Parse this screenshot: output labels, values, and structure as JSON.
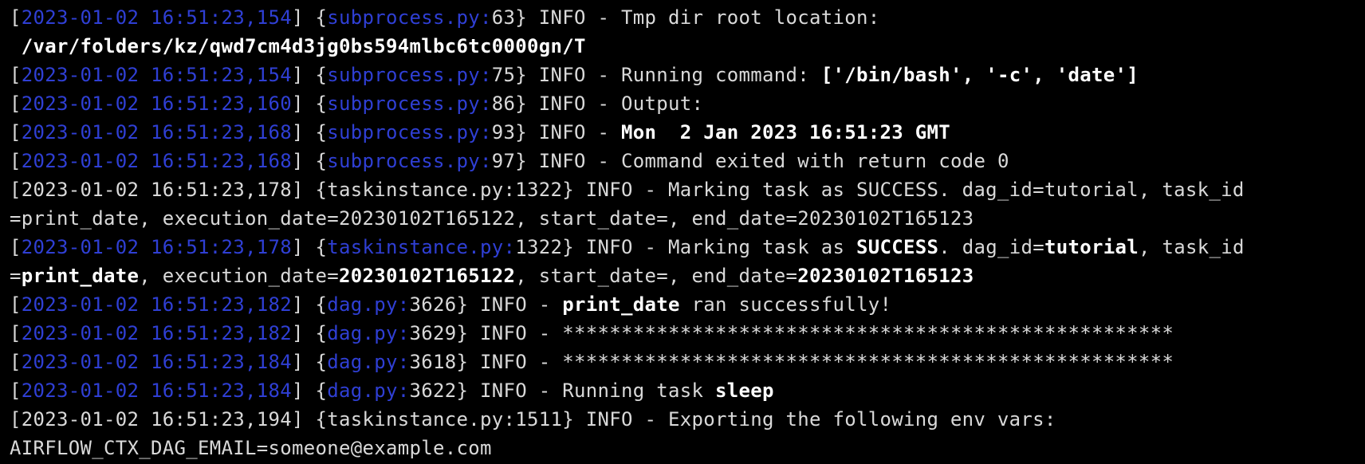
{
  "terminal": {
    "lines": [
      {
        "segments": [
          {
            "text": "[",
            "style": "plain"
          },
          {
            "text": "2023-01-02 16:51:23,154",
            "style": "ts"
          },
          {
            "text": "] {",
            "style": "plain"
          },
          {
            "text": "subprocess.py:",
            "style": "src"
          },
          {
            "text": "63} INFO - Tmp dir root location:",
            "style": "plain"
          }
        ]
      },
      {
        "segments": [
          {
            "text": " /var/folders/kz/qwd7cm4d3jg0bs594mlbc6tc0000gn/T",
            "style": "b"
          }
        ]
      },
      {
        "segments": [
          {
            "text": "[",
            "style": "plain"
          },
          {
            "text": "2023-01-02 16:51:23,154",
            "style": "ts"
          },
          {
            "text": "] {",
            "style": "plain"
          },
          {
            "text": "subprocess.py:",
            "style": "src"
          },
          {
            "text": "75} INFO - Running command: ",
            "style": "plain"
          },
          {
            "text": "['/bin/bash', '-c', 'date']",
            "style": "b"
          }
        ]
      },
      {
        "segments": [
          {
            "text": "[",
            "style": "plain"
          },
          {
            "text": "2023-01-02 16:51:23,160",
            "style": "ts"
          },
          {
            "text": "] {",
            "style": "plain"
          },
          {
            "text": "subprocess.py:",
            "style": "src"
          },
          {
            "text": "86} INFO - Output:",
            "style": "plain"
          }
        ]
      },
      {
        "segments": [
          {
            "text": "[",
            "style": "plain"
          },
          {
            "text": "2023-01-02 16:51:23,168",
            "style": "ts"
          },
          {
            "text": "] {",
            "style": "plain"
          },
          {
            "text": "subprocess.py:",
            "style": "src"
          },
          {
            "text": "93} INFO - ",
            "style": "plain"
          },
          {
            "text": "Mon  2 Jan 2023 16:51:23 GMT",
            "style": "b"
          }
        ]
      },
      {
        "segments": [
          {
            "text": "[",
            "style": "plain"
          },
          {
            "text": "2023-01-02 16:51:23,168",
            "style": "ts"
          },
          {
            "text": "] {",
            "style": "plain"
          },
          {
            "text": "subprocess.py:",
            "style": "src"
          },
          {
            "text": "97} INFO - Command exited with return code 0",
            "style": "plain"
          }
        ]
      },
      {
        "segments": [
          {
            "text": "[2023-01-02 16:51:23,178] {taskinstance.py:1322} INFO - Marking task as SUCCESS. dag_id=tutorial, task_id",
            "style": "plain"
          }
        ]
      },
      {
        "segments": [
          {
            "text": "=print_date, execution_date=20230102T165122, start_date=, end_date=20230102T165123",
            "style": "plain"
          }
        ]
      },
      {
        "segments": [
          {
            "text": "[",
            "style": "plain"
          },
          {
            "text": "2023-01-02 16:51:23,178",
            "style": "ts"
          },
          {
            "text": "] {",
            "style": "plain"
          },
          {
            "text": "taskinstance.py:",
            "style": "src"
          },
          {
            "text": "1322} INFO - Marking task as ",
            "style": "plain"
          },
          {
            "text": "SUCCESS",
            "style": "b"
          },
          {
            "text": ". dag_id=",
            "style": "plain"
          },
          {
            "text": "tutorial",
            "style": "b"
          },
          {
            "text": ", task_id",
            "style": "plain"
          }
        ]
      },
      {
        "segments": [
          {
            "text": "=",
            "style": "plain"
          },
          {
            "text": "print_date",
            "style": "b"
          },
          {
            "text": ", execution_date=",
            "style": "plain"
          },
          {
            "text": "20230102T165122",
            "style": "b"
          },
          {
            "text": ", start_date=, end_date=",
            "style": "plain"
          },
          {
            "text": "20230102T165123",
            "style": "b"
          }
        ]
      },
      {
        "segments": [
          {
            "text": "[",
            "style": "plain"
          },
          {
            "text": "2023-01-02 16:51:23,182",
            "style": "ts"
          },
          {
            "text": "] {",
            "style": "plain"
          },
          {
            "text": "dag.py:",
            "style": "src"
          },
          {
            "text": "3626} INFO - ",
            "style": "plain"
          },
          {
            "text": "print_date",
            "style": "b"
          },
          {
            "text": " ran successfully!",
            "style": "plain"
          }
        ]
      },
      {
        "segments": [
          {
            "text": "[",
            "style": "plain"
          },
          {
            "text": "2023-01-02 16:51:23,182",
            "style": "ts"
          },
          {
            "text": "] {",
            "style": "plain"
          },
          {
            "text": "dag.py:",
            "style": "src"
          },
          {
            "text": "3629} INFO - ****************************************************",
            "style": "plain"
          }
        ]
      },
      {
        "segments": [
          {
            "text": "[",
            "style": "plain"
          },
          {
            "text": "2023-01-02 16:51:23,184",
            "style": "ts"
          },
          {
            "text": "] {",
            "style": "plain"
          },
          {
            "text": "dag.py:",
            "style": "src"
          },
          {
            "text": "3618} INFO - ****************************************************",
            "style": "plain"
          }
        ]
      },
      {
        "segments": [
          {
            "text": "[",
            "style": "plain"
          },
          {
            "text": "2023-01-02 16:51:23,184",
            "style": "ts"
          },
          {
            "text": "] {",
            "style": "plain"
          },
          {
            "text": "dag.py:",
            "style": "src"
          },
          {
            "text": "3622} INFO - Running task ",
            "style": "plain"
          },
          {
            "text": "sleep",
            "style": "b"
          }
        ]
      },
      {
        "segments": [
          {
            "text": "[2023-01-02 16:51:23,194] {taskinstance.py:1511} INFO - Exporting the following env vars:",
            "style": "plain"
          }
        ]
      },
      {
        "segments": [
          {
            "text": "AIRFLOW_CTX_DAG_EMAIL=someone@example.com",
            "style": "plain"
          }
        ]
      }
    ],
    "colors": {
      "background": "#000000",
      "text": "#d9d9d9",
      "highlight_blue": "#2f3fd4",
      "bold_text": "#ffffff"
    }
  }
}
